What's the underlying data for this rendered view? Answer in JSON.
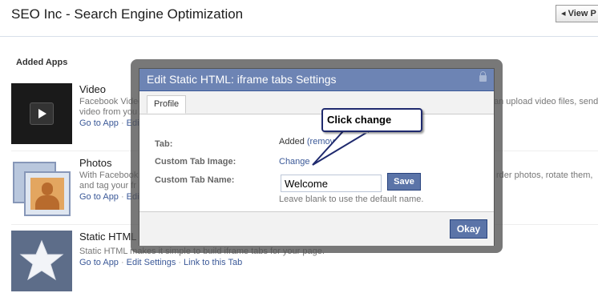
{
  "page": {
    "title": "SEO Inc - Search Engine Optimization",
    "view_button": "◂ View P"
  },
  "section": {
    "title": "Added Apps"
  },
  "apps": [
    {
      "name": "Video",
      "description": "Facebook Video",
      "description_line2": "video from you",
      "right_text": "an upload video files, send",
      "links": [
        "Go to App",
        "Edit"
      ]
    },
    {
      "name": "Photos",
      "description": "With Facebook",
      "description_line2": "and tag your fr",
      "right_text": "rder photos, rotate them,",
      "links": [
        "Go to App",
        "Edit"
      ]
    },
    {
      "name": "Static HTML",
      "description": "Static HTML makes it simple to build iframe tabs for your page.",
      "links": [
        "Go to App",
        "Edit Settings",
        "Link to this Tab"
      ]
    }
  ],
  "dialog": {
    "title": "Edit Static HTML: iframe tabs Settings",
    "tab": "Profile",
    "rows": {
      "tab_label": "Tab:",
      "tab_value": "Added",
      "tab_remove": "(remove)",
      "image_label": "Custom Tab Image:",
      "image_value": "Change",
      "name_label": "Custom Tab Name:",
      "name_value": "Welcome",
      "save_label": "Save",
      "hint": "Leave blank to use the default name."
    },
    "okay_label": "Okay"
  },
  "callout": {
    "text": "Click change"
  },
  "colors": {
    "fb_blue": "#3b5998",
    "header_blue": "#6d84b4",
    "button_blue": "#5b74a8"
  }
}
